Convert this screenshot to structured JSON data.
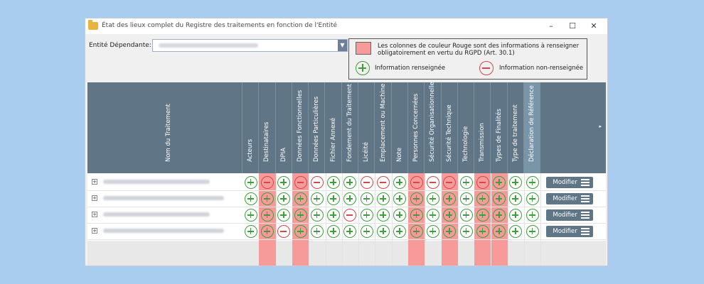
{
  "window": {
    "title": "État des lieux complet du Registre des traitements en fonction de l'Entité",
    "controls": [
      "minimize-icon",
      "maximize-icon",
      "close-icon"
    ]
  },
  "entity": {
    "label": "Entité Dépendante:",
    "value": ""
  },
  "legend": {
    "red_text": "Les colonnes de couleur Rouge sont des informations à renseigner obligatoirement en vertu du RGPD (Art. 30.1)",
    "filled_label": "Information renseignée",
    "empty_label": "Information non-renseignée",
    "colors": {
      "required": "#f79a9a",
      "filled": "#3e9e3e",
      "empty": "#d44848",
      "header": "#607686"
    }
  },
  "grid": {
    "name_header": "Nom du Traitement",
    "columns": [
      {
        "label": "Acteurs",
        "required": false
      },
      {
        "label": "Destinataires",
        "required": true
      },
      {
        "label": "DPIA",
        "required": false
      },
      {
        "label": "Données Fonctionnelles",
        "required": true
      },
      {
        "label": "Données Particulières",
        "required": false
      },
      {
        "label": "Fichier Annexé",
        "required": false
      },
      {
        "label": "Fondement du Traitement",
        "required": false
      },
      {
        "label": "Licéité",
        "required": false
      },
      {
        "label": "Emplacement ou Machine",
        "required": false
      },
      {
        "label": "Note",
        "required": false
      },
      {
        "label": "Personnes Concernées",
        "required": true
      },
      {
        "label": "Sécurité Organisationnelle",
        "required": false
      },
      {
        "label": "Sécurité Technique",
        "required": true
      },
      {
        "label": "Technologie",
        "required": false
      },
      {
        "label": "Transmission",
        "required": true
      },
      {
        "label": "Types de Finalités",
        "required": true
      },
      {
        "label": "Type de traitement",
        "required": false
      },
      {
        "label": "Déclaration de Référence",
        "required": false
      }
    ],
    "action_label": "Modifier",
    "rows": [
      {
        "name": "",
        "values": [
          "+",
          "-",
          "+",
          "-",
          "-",
          "+",
          "+",
          "-",
          "-",
          "+",
          "-",
          "-",
          "-",
          "+",
          "-",
          "+",
          "+",
          "+"
        ]
      },
      {
        "name": "",
        "values": [
          "+",
          "+",
          "+",
          "+",
          "+",
          "+",
          "+",
          "+",
          "+",
          "+",
          "+",
          "+",
          "+",
          "+",
          "+",
          "+",
          "+",
          "+"
        ]
      },
      {
        "name": "",
        "values": [
          "+",
          "+",
          "+",
          "+",
          "+",
          "+",
          "-",
          "+",
          "+",
          "+",
          "+",
          "+",
          "+",
          "+",
          "+",
          "+",
          "+",
          "+"
        ]
      },
      {
        "name": "",
        "values": [
          "+",
          "+",
          "-",
          "+",
          "+",
          "+",
          "+",
          "+",
          "+",
          "+",
          "+",
          "+",
          "+",
          "+",
          "+",
          "+",
          "+",
          "+"
        ]
      }
    ]
  }
}
